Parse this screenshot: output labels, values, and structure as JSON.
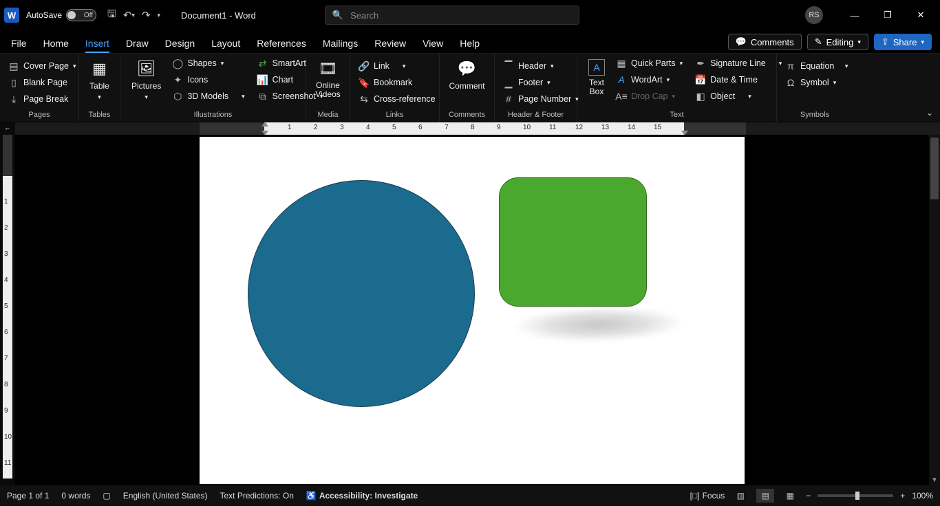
{
  "titlebar": {
    "autosave_label": "AutoSave",
    "autosave_state": "Off",
    "document_title": "Document1  -  Word",
    "search_placeholder": "Search",
    "user_initials": "RS"
  },
  "tabs": {
    "items": [
      "File",
      "Home",
      "Insert",
      "Draw",
      "Design",
      "Layout",
      "References",
      "Mailings",
      "Review",
      "View",
      "Help"
    ],
    "active_index": 2,
    "comments": "Comments",
    "editing": "Editing",
    "share": "Share"
  },
  "ribbon": {
    "pages": {
      "label": "Pages",
      "cover_page": "Cover Page",
      "blank_page": "Blank Page",
      "page_break": "Page Break"
    },
    "tables": {
      "label": "Tables",
      "table": "Table"
    },
    "illustrations": {
      "label": "Illustrations",
      "pictures": "Pictures",
      "shapes": "Shapes",
      "icons": "Icons",
      "models": "3D Models",
      "smartart": "SmartArt",
      "chart": "Chart",
      "screenshot": "Screenshot"
    },
    "media": {
      "label": "Media",
      "online_videos": "Online Videos"
    },
    "links": {
      "label": "Links",
      "link": "Link",
      "bookmark": "Bookmark",
      "crossref": "Cross-reference"
    },
    "comments": {
      "label": "Comments",
      "comment": "Comment"
    },
    "headerfooter": {
      "label": "Header & Footer",
      "header": "Header",
      "footer": "Footer",
      "page_number": "Page Number"
    },
    "text": {
      "label": "Text",
      "text_box": "Text Box",
      "quick_parts": "Quick Parts",
      "wordart": "WordArt",
      "drop_cap": "Drop Cap",
      "sig_line": "Signature Line",
      "date_time": "Date & Time",
      "object": "Object"
    },
    "symbols": {
      "label": "Symbols",
      "equation": "Equation",
      "symbol": "Symbol"
    }
  },
  "ruler": {
    "numbers": [
      1,
      2,
      3,
      4,
      5,
      6,
      7,
      8,
      9,
      10,
      11,
      12,
      13,
      14,
      15
    ]
  },
  "vruler": {
    "numbers": [
      1,
      2,
      3,
      4,
      5,
      6,
      7,
      8,
      9,
      10,
      11
    ]
  },
  "document": {
    "shapes": {
      "circle": {
        "fill": "#1b6b8f"
      },
      "rounded_rect": {
        "fill": "#4ba82e"
      }
    }
  },
  "status": {
    "page": "Page 1 of 1",
    "words": "0 words",
    "language": "English (United States)",
    "predictions": "Text Predictions: On",
    "accessibility": "Accessibility: Investigate",
    "focus": "Focus",
    "zoom": "100%"
  }
}
